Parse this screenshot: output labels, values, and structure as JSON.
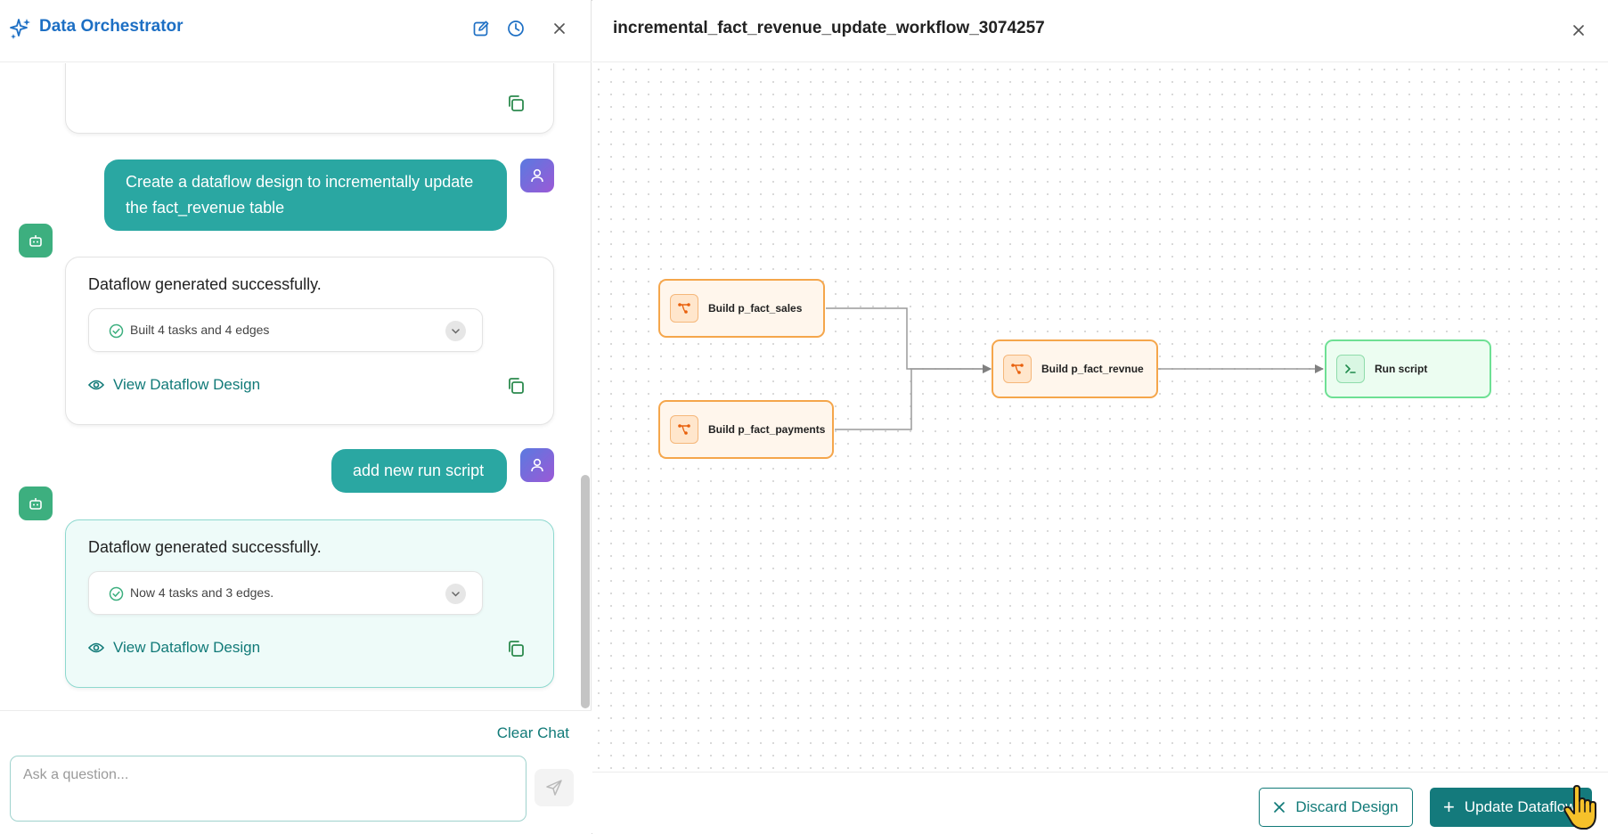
{
  "chat": {
    "app_title": "Data Orchestrator",
    "messages": {
      "user_1": "Create a dataflow design to incrementally update the fact_revenue table",
      "bot_1": {
        "title": "Dataflow generated successfully.",
        "status": "Built 4 tasks and 4 edges",
        "link": "View Dataflow Design"
      },
      "user_2": "add new run script",
      "bot_2": {
        "title": "Dataflow generated successfully.",
        "status": "Now 4 tasks and 3 edges.",
        "link": "View Dataflow Design"
      }
    },
    "clear_label": "Clear Chat",
    "input_placeholder": "Ask a question..."
  },
  "workflow": {
    "title": "incremental_fact_revenue_update_workflow_3074257",
    "nodes": {
      "sales": "Build p_fact_sales",
      "payments": "Build p_fact_payments",
      "revenue": "Build p_fact_revnue",
      "script": "Run script"
    },
    "discard_label": "Discard Design",
    "update_label": "Update Dataflow"
  },
  "colors": {
    "accent": "#147a7c",
    "brand": "#1d6fc4",
    "user_bubble": "#2aa7a2",
    "task_node_border": "#f5a64b",
    "script_node_border": "#6ee094"
  }
}
